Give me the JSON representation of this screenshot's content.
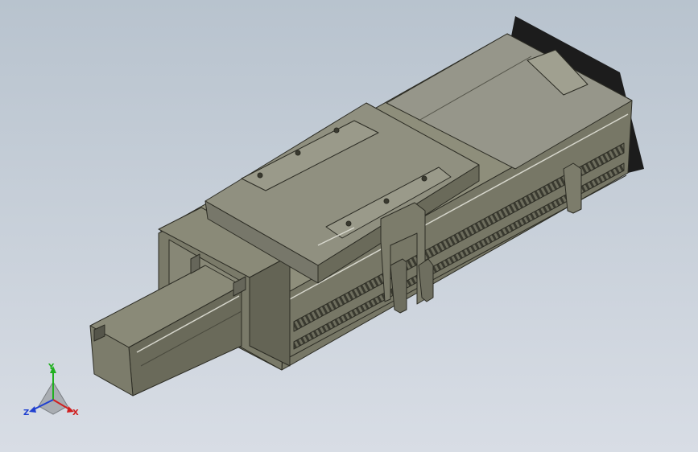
{
  "viewport": {
    "background_top": "#b9c4cf",
    "background_bottom": "#d9dee6",
    "model_colors": {
      "top": "#8f8f7c",
      "side_light": "#7b7b6a",
      "side_dark": "#5f5f51",
      "edge": "#2e2e26",
      "highlight": "#d9d9cf",
      "shadow": "#1a1a1a"
    }
  },
  "triad": {
    "x_label": "X",
    "y_label": "Y",
    "z_label": "Z",
    "x_color": "#d02020",
    "y_color": "#20b020",
    "z_color": "#2040d0"
  }
}
